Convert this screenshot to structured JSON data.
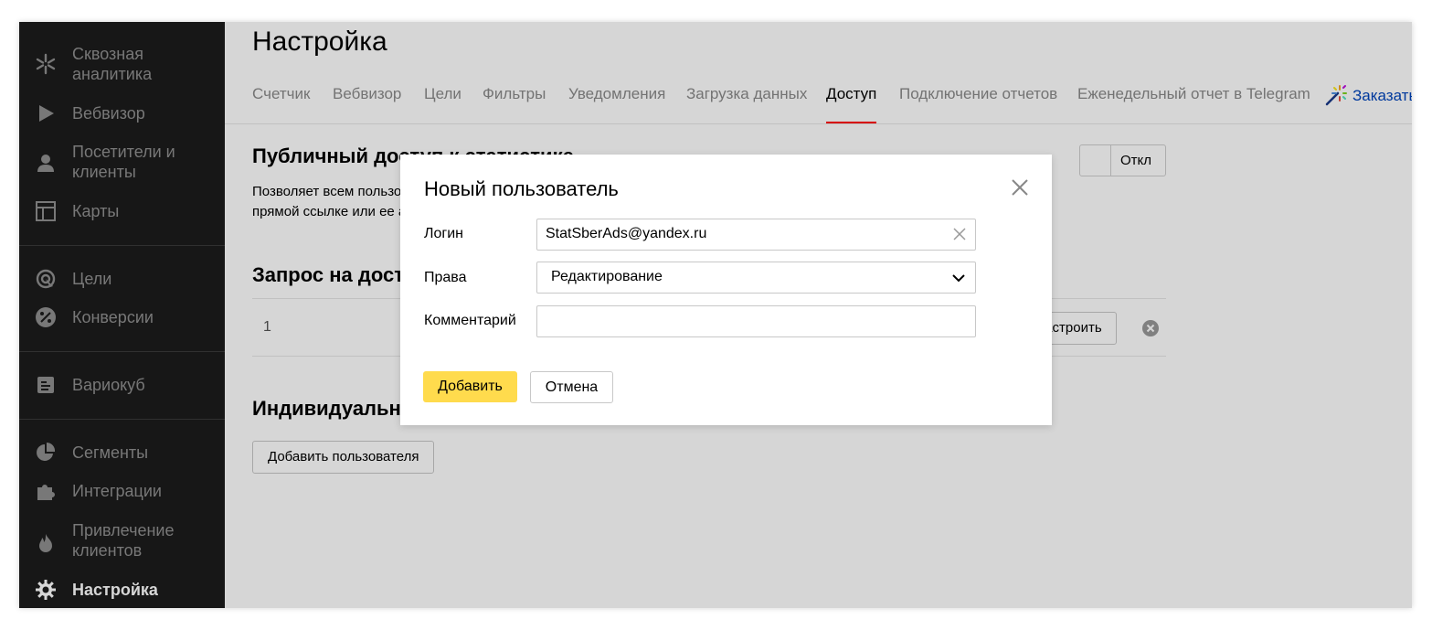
{
  "sidebar": {
    "items": [
      {
        "label": "Сквозная аналитика",
        "icon": "snowflake-icon"
      },
      {
        "label": "Вебвизор",
        "icon": "play-icon"
      },
      {
        "label": "Посетители и клиенты",
        "icon": "user-icon"
      },
      {
        "label": "Карты",
        "icon": "map-layout-icon"
      },
      {
        "label": "Цели",
        "icon": "target-icon"
      },
      {
        "label": "Конверсии",
        "icon": "percent-icon"
      },
      {
        "label": "Вариокуб",
        "icon": "cube-icon"
      },
      {
        "label": "Сегменты",
        "icon": "pie-chart-icon"
      },
      {
        "label": "Интеграции",
        "icon": "puzzle-icon"
      },
      {
        "label": "Привлечение клиентов",
        "icon": "flame-icon"
      },
      {
        "label": "Настройка",
        "icon": "gear-icon",
        "active": true
      }
    ]
  },
  "main": {
    "title": "Настройка",
    "tabs": [
      {
        "label": "Счетчик"
      },
      {
        "label": "Вебвизор"
      },
      {
        "label": "Цели"
      },
      {
        "label": "Фильтры"
      },
      {
        "label": "Уведомления"
      },
      {
        "label": "Загрузка данных"
      },
      {
        "label": "Доступ",
        "active": true
      },
      {
        "label": "Подключение отчетов"
      },
      {
        "label": "Еженедельный отчет в Telegram"
      }
    ],
    "order_link": "Заказать",
    "public_access": {
      "title": "Публичный доступ к статистике",
      "desc_line1": "Позволяет всем пользователям просматривать статистику по",
      "desc_line2": "прямой ссылке или ее адресу",
      "toggle_label": "Откл"
    },
    "requests": {
      "title": "Запрос на доступ",
      "row_number": "1",
      "configure_label": "Настроить"
    },
    "individual": {
      "title": "Индивидуальный доступ",
      "add_user_label": "Добавить пользователя"
    }
  },
  "modal": {
    "title": "Новый пользователь",
    "login_label": "Логин",
    "login_value": "StatSberAds@yandex.ru",
    "rights_label": "Права",
    "rights_value": "Редактирование",
    "comment_label": "Комментарий",
    "comment_value": "",
    "add_button": "Добавить",
    "cancel_button": "Отмена"
  },
  "colors": {
    "sidebar_bg": "#1c1c1c",
    "accent_underline": "#ff0000",
    "primary_button": "#ffdb4d",
    "link": "#0044bb"
  }
}
